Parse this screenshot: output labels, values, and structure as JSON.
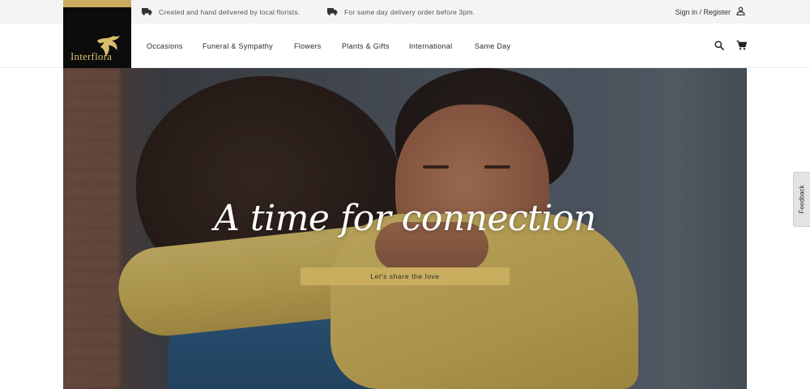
{
  "topbar": {
    "message_1": "Created and hand delivered by local florists.",
    "message_2": "For same day delivery order before 3pm.",
    "signin_label": "Sign in / Register",
    "truck_icon": "truck-icon",
    "user_icon": "user-icon"
  },
  "logo": {
    "text": "Interflora",
    "accent_color": "#c9ad5d"
  },
  "nav": {
    "items": [
      {
        "label": "Occasions"
      },
      {
        "label": "Funeral & Sympathy"
      },
      {
        "label": "Flowers"
      },
      {
        "label": "Plants & Gifts"
      },
      {
        "label": "International"
      },
      {
        "label": "Same Day"
      }
    ],
    "search_icon": "search-icon",
    "cart_icon": "cart-icon"
  },
  "hero": {
    "title": "A time for connection",
    "cta_label": "Let's share the love",
    "cta_color": "#c8ad5e"
  },
  "feedback": {
    "label": "Feedback"
  }
}
